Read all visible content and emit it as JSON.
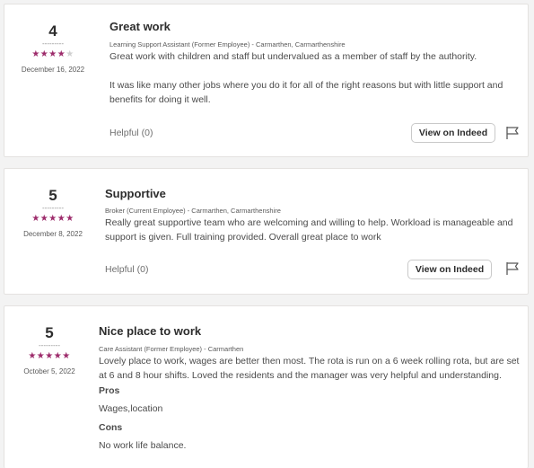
{
  "reviews": [
    {
      "rating": "4",
      "stars_filled": 4,
      "stars_total": 5,
      "date": "December 16, 2022",
      "title": "Great work",
      "meta": "Learning Support Assistant (Former Employee) - Carmarthen, Carmarthenshire",
      "body": [
        "Great work with children and staff but undervalued as a member of staff by the authority.",
        "It was like many other jobs where you do it for all of the right reasons but with little support and benefits for doing it well."
      ],
      "helpful": "Helpful (0)",
      "button": "View on Indeed"
    },
    {
      "rating": "5",
      "stars_filled": 5,
      "stars_total": 5,
      "date": "December 8, 2022",
      "title": "Supportive",
      "meta": "Broker (Current Employee) - Carmarthen, Carmarthenshire",
      "body": [
        "Really great supportive team  who are welcoming and willing to help. Workload is manageable and support is given. Full training provided. Overall great place to work"
      ],
      "helpful": "Helpful (0)",
      "button": "View on Indeed"
    },
    {
      "rating": "5",
      "stars_filled": 5,
      "stars_total": 5,
      "date": "October 5, 2022",
      "title": "Nice place to work",
      "meta": "Care Assistant (Former Employee) - Carmarthen",
      "body": [
        "Lovely place to work, wages are better then most.  The rota is run on a 6 week rolling rota, but are set at 6 and 8 hour shifts.   Loved the residents and the manager was very helpful and understanding."
      ],
      "pros_label": "Pros",
      "pros": "Wages,location",
      "cons_label": "Cons",
      "cons": "No work life balance."
    }
  ],
  "colors": {
    "star": "#9d2b6b",
    "star_empty": "#cfcfcf"
  },
  "rating_divider": "---------",
  "star_glyph": "★",
  "icons": {
    "report": "flag-icon"
  }
}
